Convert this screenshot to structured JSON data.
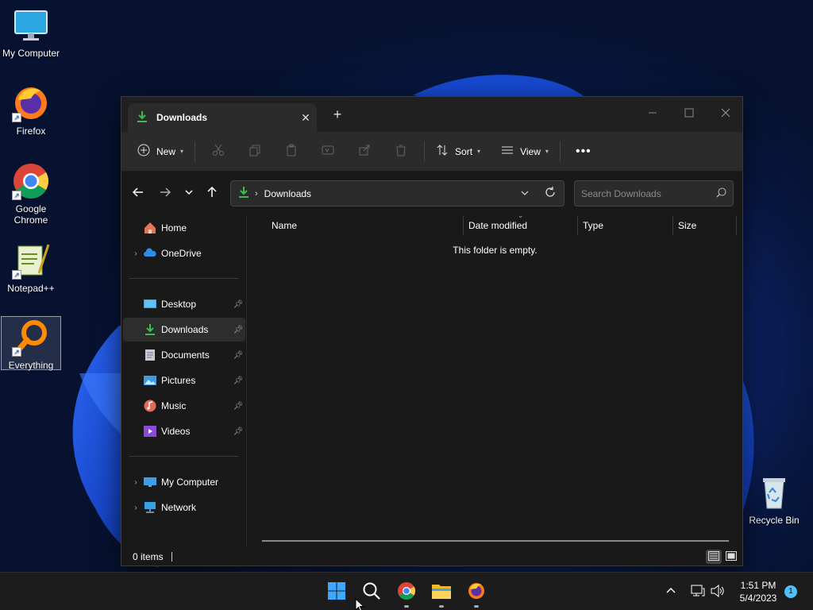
{
  "desktop": {
    "icons": [
      {
        "label": "My Computer"
      },
      {
        "label": "Firefox"
      },
      {
        "label": "Google Chrome"
      },
      {
        "label": "Notepad++"
      },
      {
        "label": "Everything"
      },
      {
        "label": "Recycle Bin"
      }
    ]
  },
  "window": {
    "tab_title": "Downloads",
    "toolbar": {
      "new_label": "New",
      "sort_label": "Sort",
      "view_label": "View"
    },
    "address": {
      "path": "Downloads",
      "search_placeholder": "Search Downloads"
    },
    "nav": {
      "quick": [
        {
          "label": "Home"
        },
        {
          "label": "OneDrive"
        }
      ],
      "pinned": [
        {
          "label": "Desktop"
        },
        {
          "label": "Downloads"
        },
        {
          "label": "Documents"
        },
        {
          "label": "Pictures"
        },
        {
          "label": "Music"
        },
        {
          "label": "Videos"
        }
      ],
      "locations": [
        {
          "label": "My Computer"
        },
        {
          "label": "Network"
        }
      ]
    },
    "columns": [
      "Name",
      "Date modified",
      "Type",
      "Size"
    ],
    "empty_message": "This folder is empty.",
    "status": {
      "items": "0 items"
    }
  },
  "taskbar": {
    "time": "1:51 PM",
    "date": "5/4/2023",
    "notification_count": "1"
  },
  "colors": {
    "accent": "#4cc2ff",
    "window_bg": "#191919",
    "toolbar_bg": "#2b2b2b",
    "download_green": "#3fb950"
  }
}
